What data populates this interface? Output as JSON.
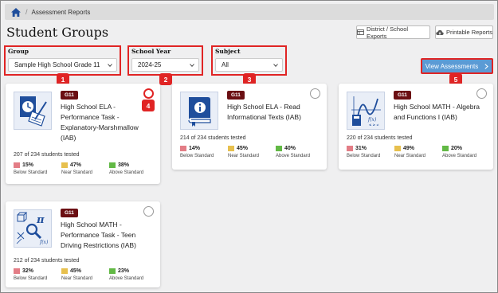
{
  "breadcrumb": {
    "current": "Assessment Reports"
  },
  "page_title": "Student Groups",
  "top_buttons": {
    "district_exports": "District / School Exports",
    "printable_reports": "Printable Reports"
  },
  "filters": {
    "group": {
      "label": "Group",
      "value": "Sample High School Grade 11",
      "badge": "1"
    },
    "school_year": {
      "label": "School Year",
      "value": "2024-25",
      "badge": "2"
    },
    "subject": {
      "label": "Subject",
      "value": "All",
      "badge": "3"
    }
  },
  "view_assessments": {
    "label": "View Assessments",
    "badge": "5"
  },
  "radio_badge": "4",
  "colors": {
    "below": "#e37d86",
    "near": "#e7c04e",
    "above": "#62b945",
    "accent": "#5b9bd5",
    "badge": "#e02424",
    "grade": "#6b0f13"
  },
  "stat_labels": {
    "below": "Below Standard",
    "near": "Near Standard",
    "above": "Above Standard"
  },
  "cards": [
    {
      "grade": "G11",
      "title": "High School ELA - Performance Task - Explanatory-Marshmallow (IAB)",
      "tested": "207 of 234 students tested",
      "below": "15%",
      "near": "47%",
      "above": "38%",
      "icon": "ela-performance-task-icon"
    },
    {
      "grade": "G11",
      "title": "High School ELA - Read Informational Texts (IAB)",
      "tested": "214 of 234 students tested",
      "below": "14%",
      "near": "45%",
      "above": "40%",
      "icon": "ela-book-info-icon"
    },
    {
      "grade": "G11",
      "title": "High School MATH - Algebra and Functions I (IAB)",
      "tested": "220 of 234 students tested",
      "below": "31%",
      "near": "49%",
      "above": "20%",
      "icon": "math-graph-calculator-icon"
    },
    {
      "grade": "G11",
      "title": "High School MATH - Performance Task - Teen Driving Restrictions (IAB)",
      "tested": "212 of 234 students tested",
      "below": "32%",
      "near": "45%",
      "above": "23%",
      "icon": "math-performance-task-icon"
    }
  ]
}
